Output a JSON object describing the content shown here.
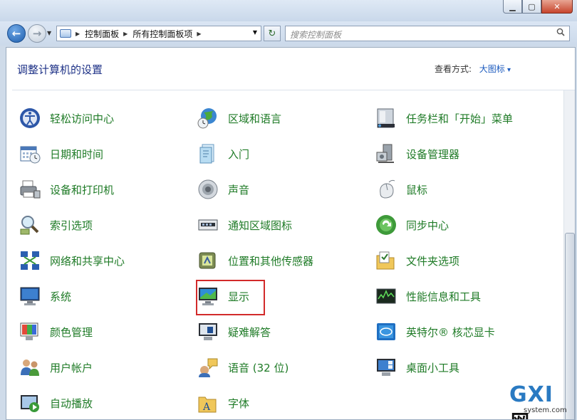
{
  "nav": {
    "breadcrumb": [
      "控制面板",
      "所有控制面板项"
    ],
    "search_placeholder": "搜索控制面板"
  },
  "header": {
    "title": "调整计算机的设置",
    "view_by_label": "查看方式:",
    "view_mode": "大图标"
  },
  "items": [
    {
      "label": "轻松访问中心",
      "icon": "ease-of-access-icon"
    },
    {
      "label": "区域和语言",
      "icon": "globe-clock-icon"
    },
    {
      "label": "任务栏和「开始」菜单",
      "icon": "taskbar-icon"
    },
    {
      "label": "日期和时间",
      "icon": "calendar-clock-icon"
    },
    {
      "label": "入门",
      "icon": "getting-started-icon"
    },
    {
      "label": "设备管理器",
      "icon": "device-manager-icon"
    },
    {
      "label": "设备和打印机",
      "icon": "printer-icon"
    },
    {
      "label": "声音",
      "icon": "speaker-icon"
    },
    {
      "label": "鼠标",
      "icon": "mouse-icon"
    },
    {
      "label": "索引选项",
      "icon": "magnifier-icon"
    },
    {
      "label": "通知区域图标",
      "icon": "notification-tray-icon"
    },
    {
      "label": "同步中心",
      "icon": "sync-icon"
    },
    {
      "label": "网络和共享中心",
      "icon": "network-icon"
    },
    {
      "label": "位置和其他传感器",
      "icon": "sensor-icon"
    },
    {
      "label": "文件夹选项",
      "icon": "folder-options-icon"
    },
    {
      "label": "系统",
      "icon": "system-icon"
    },
    {
      "label": "显示",
      "icon": "display-icon"
    },
    {
      "label": "性能信息和工具",
      "icon": "performance-icon"
    },
    {
      "label": "颜色管理",
      "icon": "color-management-icon"
    },
    {
      "label": "疑难解答",
      "icon": "troubleshooting-icon"
    },
    {
      "label": "英特尔® 核芯显卡",
      "icon": "intel-graphics-icon"
    },
    {
      "label": "用户帐户",
      "icon": "user-accounts-icon"
    },
    {
      "label": "语音 (32 位)",
      "icon": "speech-icon"
    },
    {
      "label": "桌面小工具",
      "icon": "gadgets-icon"
    },
    {
      "label": "自动播放",
      "icon": "autoplay-icon"
    },
    {
      "label": "字体",
      "icon": "fonts-icon"
    }
  ],
  "watermark": {
    "brand": "GXI",
    "brand_cn": "网",
    "domain": "system.com"
  }
}
